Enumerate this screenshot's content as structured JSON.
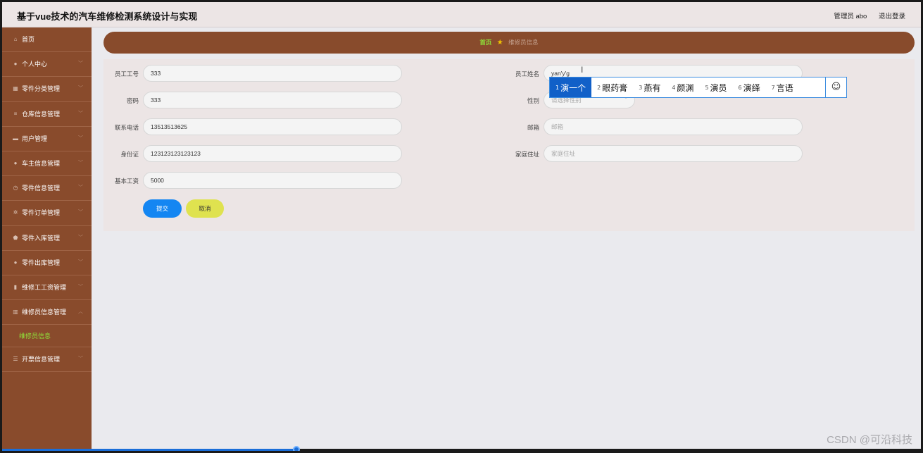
{
  "header": {
    "app_title": "基于vue技术的汽车维修检测系统设计与实现",
    "user_label": "管理员 abo",
    "logout_label": "退出登录"
  },
  "sidebar": {
    "items": [
      {
        "label": "首页",
        "icon": "home-icon",
        "chevron": false
      },
      {
        "label": "个人中心",
        "icon": "user-icon",
        "chevron": true
      },
      {
        "label": "零件分类管理",
        "icon": "grid-icon",
        "chevron": true
      },
      {
        "label": "仓库信息管理",
        "icon": "list-icon",
        "chevron": true
      },
      {
        "label": "用户管理",
        "icon": "monitor-icon",
        "chevron": true
      },
      {
        "label": "车主信息管理",
        "icon": "person-icon",
        "chevron": true
      },
      {
        "label": "零件信息管理",
        "icon": "clock-icon",
        "chevron": true
      },
      {
        "label": "零件订单管理",
        "icon": "settings-icon",
        "chevron": true
      },
      {
        "label": "零件入库管理",
        "icon": "shield-icon",
        "chevron": true
      },
      {
        "label": "零件出库管理",
        "icon": "location-icon",
        "chevron": true
      },
      {
        "label": "维修工工资管理",
        "icon": "building-icon",
        "chevron": true
      },
      {
        "label": "维修员信息管理",
        "icon": "chart-icon",
        "chevron": true
      }
    ],
    "sub_item": "维修员信息",
    "last_item": {
      "label": "开票信息管理",
      "icon": "menu-icon",
      "chevron": true
    }
  },
  "breadcrumb": {
    "home": "首页",
    "current": "维修员信息"
  },
  "form": {
    "employee_no_label": "员工工号",
    "employee_no_value": "333",
    "employee_name_label": "员工姓名",
    "employee_name_value": "yan'y'g",
    "password_label": "密码",
    "password_value": "333",
    "gender_label": "性别",
    "gender_placeholder": "请选择性别",
    "phone_label": "联系电话",
    "phone_value": "13513513625",
    "email_label": "邮箱",
    "email_placeholder": "邮箱",
    "id_card_label": "身份证",
    "id_card_value": "123123123123123",
    "address_label": "家庭住址",
    "address_placeholder": "家庭住址",
    "salary_label": "基本工资",
    "salary_value": "5000",
    "submit_label": "提交",
    "cancel_label": "取消"
  },
  "ime": {
    "candidates": [
      {
        "num": "1",
        "text": "演一个"
      },
      {
        "num": "2",
        "text": "眼药膏"
      },
      {
        "num": "3",
        "text": "燕有"
      },
      {
        "num": "4",
        "text": "颜渊"
      },
      {
        "num": "5",
        "text": "演员"
      },
      {
        "num": "6",
        "text": "演绎"
      },
      {
        "num": "7",
        "text": "言语"
      }
    ],
    "emoji": "☺"
  },
  "watermark": "CSDN @可沿科技",
  "video_progress": 0.32,
  "colors": {
    "sidebar": "#894b2c",
    "accent_green": "#8fe23a",
    "submit_blue": "#1486f2",
    "cancel_yellow": "#dfe24f",
    "ime_active": "#1160c8"
  }
}
